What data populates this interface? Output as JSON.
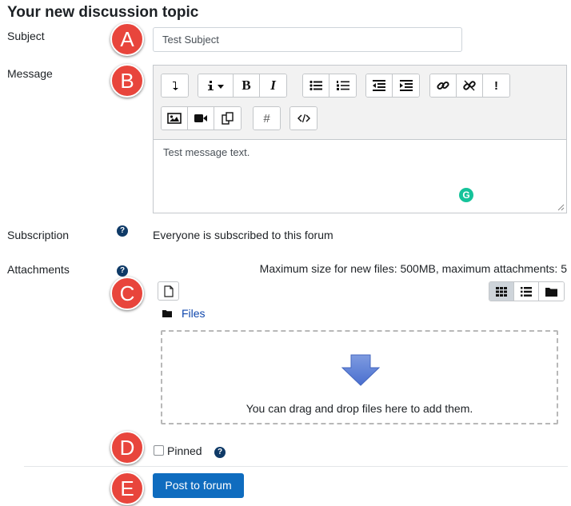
{
  "form": {
    "title": "Your new discussion topic",
    "subject": {
      "label": "Subject",
      "value": "Test Subject"
    },
    "message": {
      "label": "Message",
      "value": "Test message text."
    },
    "subscription": {
      "label": "Subscription",
      "text": "Everyone is subscribed to this forum"
    },
    "attachments": {
      "label": "Attachments",
      "limits": "Maximum size for new files: 500MB, maximum attachments: 5",
      "folder": "Files",
      "drop_text": "You can drag and drop files here to add them."
    },
    "pinned": {
      "label": "Pinned",
      "checked": false
    },
    "submit": {
      "label": "Post to forum"
    }
  },
  "markers": [
    "A",
    "B",
    "C",
    "D",
    "E"
  ],
  "editor_toolbar": {
    "row1": [
      [
        "collapse-icon"
      ],
      [
        "paragraph-style-icon",
        "bold-icon",
        "italic-icon"
      ],
      [
        "unordered-list-icon",
        "ordered-list-icon"
      ],
      [
        "outdent-icon",
        "indent-icon"
      ],
      [
        "link-icon",
        "unlink-icon",
        "emoji-icon"
      ]
    ],
    "row2": [
      [
        "image-icon",
        "video-icon",
        "manage-files-icon"
      ],
      [
        "equation-icon"
      ],
      [
        "html-icon"
      ]
    ]
  },
  "help_icon": "question-mark-icon",
  "colors": {
    "accent": "#0f6cbf",
    "marker": "#e8453c",
    "grammarly": "#15c39a"
  }
}
